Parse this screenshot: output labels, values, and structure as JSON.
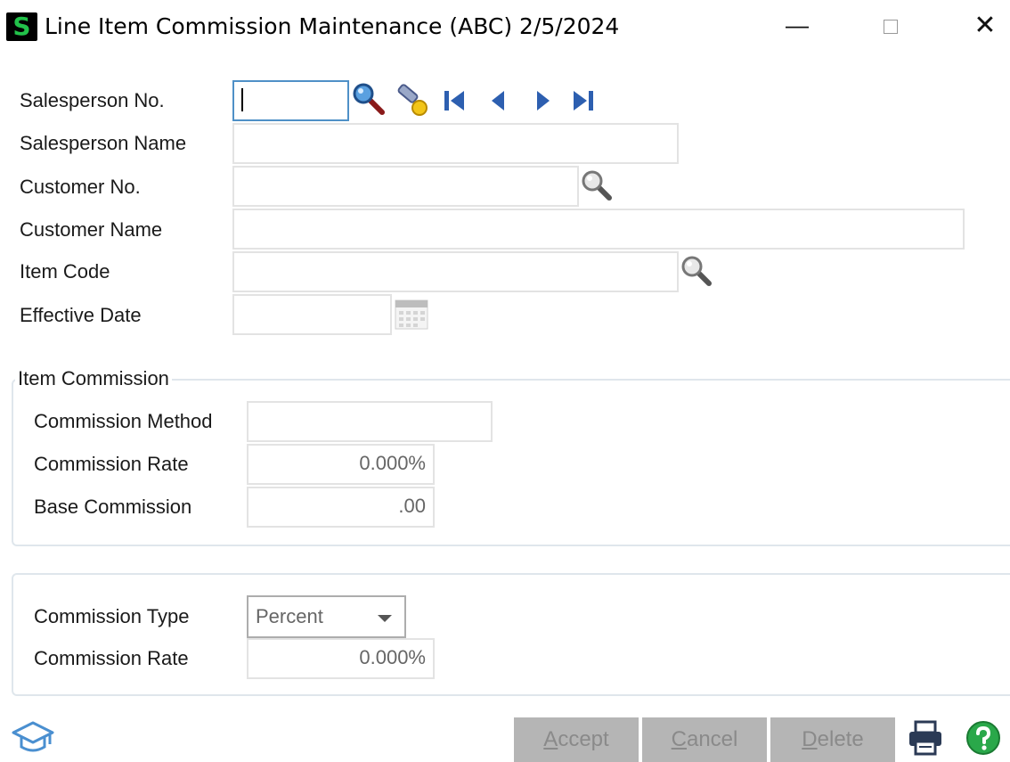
{
  "window": {
    "logo_letter": "S",
    "title": "Line Item Commission Maintenance (ABC) 2/5/2024",
    "minimize_glyph": "—",
    "close_glyph": "✕"
  },
  "form": {
    "salesperson_no": {
      "label": "Salesperson No.",
      "value": ""
    },
    "salesperson_name": {
      "label": "Salesperson Name",
      "value": ""
    },
    "customer_no": {
      "label": "Customer No.",
      "value": ""
    },
    "customer_name": {
      "label": "Customer Name",
      "value": ""
    },
    "item_code": {
      "label": "Item Code",
      "value": ""
    },
    "effective_date": {
      "label": "Effective Date",
      "value": ""
    }
  },
  "item_commission": {
    "legend": "Item Commission",
    "method": {
      "label": "Commission Method",
      "value": ""
    },
    "rate": {
      "label": "Commission Rate",
      "value": "0.000%"
    },
    "base": {
      "label": "Base Commission",
      "value": ".00"
    }
  },
  "commission": {
    "type": {
      "label": "Commission Type",
      "value": "Percent"
    },
    "rate": {
      "label": "Commission Rate",
      "value": "0.000%"
    }
  },
  "buttons": {
    "accept": {
      "key": "A",
      "rest": "ccept"
    },
    "cancel": {
      "key": "C",
      "rest": "ancel"
    },
    "delete": {
      "key": "D",
      "rest": "elete"
    }
  },
  "icons": {
    "lookup": "magnifier-icon",
    "nav": [
      "first-record-icon",
      "previous-record-icon",
      "next-record-icon",
      "last-record-icon"
    ],
    "calendar": "calendar-icon",
    "help_left": "graduation-cap-icon",
    "print": "printer-icon",
    "help": "help-icon"
  },
  "colors": {
    "focus_border": "#4f90c7",
    "logo_green": "#22c24a",
    "nav_blue": "#2d5fb0",
    "help_green": "#2aa84a",
    "disabled_button": "#b5b5b5"
  }
}
